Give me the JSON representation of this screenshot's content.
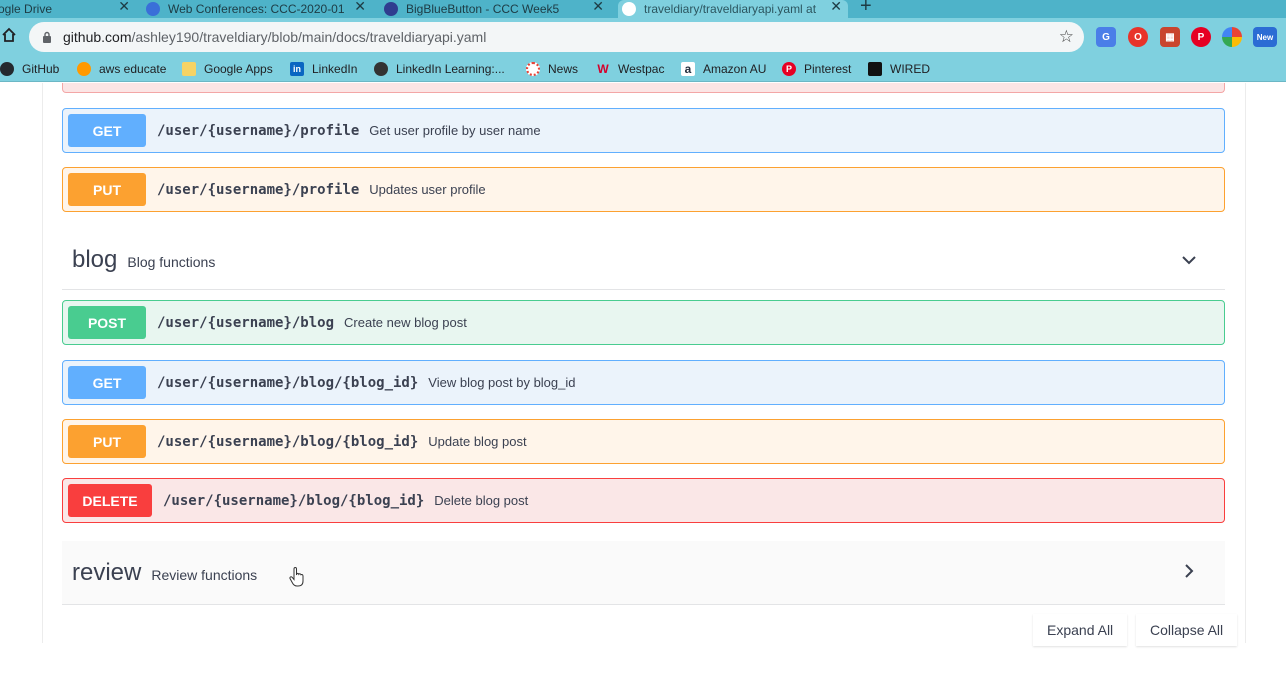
{
  "browser": {
    "tabs": [
      {
        "title": "ogle Drive",
        "icon_color": "#1fa463"
      },
      {
        "title": "Web Conferences: CCC-2020-01",
        "icon_color": "#3a6fd8"
      },
      {
        "title": "BigBlueButton - CCC Week5",
        "icon_color": "#2f3d8f"
      },
      {
        "title": "traveldiary/traveldiaryapi.yaml at",
        "icon_color": "#ffffff"
      }
    ],
    "new_tab_label": "+",
    "url_host": "github.com",
    "url_path": "/ashley190/traveldiary/blob/main/docs/traveldiaryapi.yaml",
    "bookmarks": [
      {
        "label": "GitHub",
        "icon": "github-icon",
        "color": "#24292e"
      },
      {
        "label": "aws educate",
        "icon": "aws-icon",
        "color": "#ff9900"
      },
      {
        "label": "Google Apps",
        "icon": "folder-icon",
        "color": "#f6d365"
      },
      {
        "label": "LinkedIn",
        "icon": "linkedin-icon",
        "color": "#0a66c2"
      },
      {
        "label": "LinkedIn Learning:...",
        "icon": "globe-icon",
        "color": "#333333"
      },
      {
        "label": "News",
        "icon": "news-icon",
        "color": "#e94235"
      },
      {
        "label": "Westpac",
        "icon": "westpac-icon",
        "color": "#d5002b"
      },
      {
        "label": "Amazon AU",
        "icon": "amazon-icon",
        "color": "#232f3e"
      },
      {
        "label": "Pinterest",
        "icon": "pinterest-icon",
        "color": "#e60023"
      },
      {
        "label": "WIRED",
        "icon": "wired-icon",
        "color": "#111111"
      }
    ],
    "ext_new_label": "New"
  },
  "user_ops": [
    {
      "method": "GET",
      "path": "/user/{username}/profile",
      "desc": "Get user profile by user name"
    },
    {
      "method": "PUT",
      "path": "/user/{username}/profile",
      "desc": "Updates user profile"
    }
  ],
  "blog_tag": {
    "name": "blog",
    "desc": "Blog functions"
  },
  "blog_ops": [
    {
      "method": "POST",
      "path": "/user/{username}/blog",
      "desc": "Create new blog post"
    },
    {
      "method": "GET",
      "path": "/user/{username}/blog/{blog_id}",
      "desc": "View blog post by blog_id"
    },
    {
      "method": "PUT",
      "path": "/user/{username}/blog/{blog_id}",
      "desc": "Update blog post"
    },
    {
      "method": "DELETE",
      "path": "/user/{username}/blog/{blog_id}",
      "desc": "Delete blog post"
    }
  ],
  "review_tag": {
    "name": "review",
    "desc": "Review functions"
  },
  "controls": {
    "expand_all": "Expand All",
    "collapse_all": "Collapse All"
  },
  "colors": {
    "get": "#61affe",
    "put": "#fca130",
    "post": "#49cc90",
    "delete": "#f93e3e",
    "chrome": "#7fd0df"
  }
}
